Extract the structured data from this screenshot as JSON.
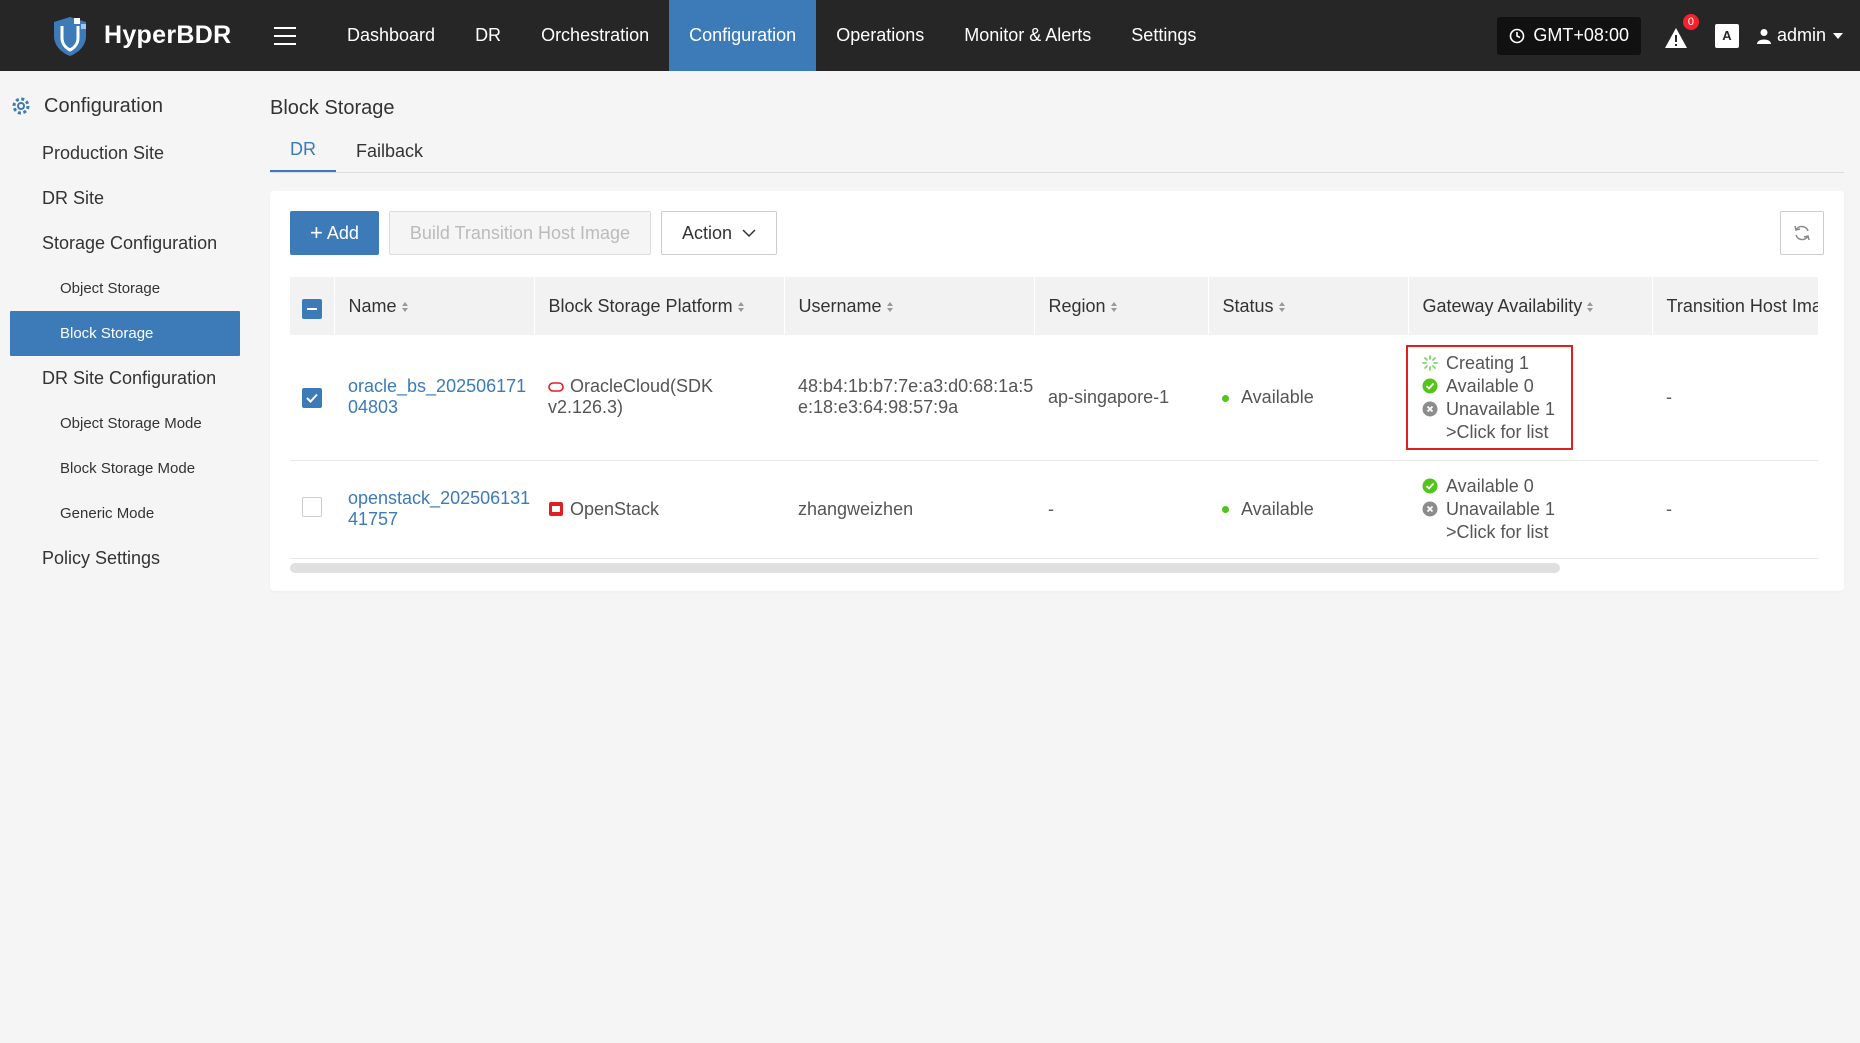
{
  "app": {
    "brand": "HyperBDR"
  },
  "nav": {
    "items": [
      {
        "label": "Dashboard",
        "active": false
      },
      {
        "label": "DR",
        "active": false
      },
      {
        "label": "Orchestration",
        "active": false
      },
      {
        "label": "Configuration",
        "active": true
      },
      {
        "label": "Operations",
        "active": false
      },
      {
        "label": "Monitor & Alerts",
        "active": false
      },
      {
        "label": "Settings",
        "active": false
      }
    ]
  },
  "header": {
    "timezone": "GMT+08:00",
    "alert_count": "0",
    "lang": "A",
    "user": "admin"
  },
  "sidebar": {
    "title": "Configuration",
    "items": [
      {
        "label": "Production Site",
        "level": 1
      },
      {
        "label": "DR Site",
        "level": 1
      },
      {
        "label": "Storage Configuration",
        "level": 1
      },
      {
        "label": "Object Storage",
        "level": 2
      },
      {
        "label": "Block Storage",
        "level": 2,
        "active": true
      },
      {
        "label": "DR Site Configuration",
        "level": 1
      },
      {
        "label": "Object Storage Mode",
        "level": 2
      },
      {
        "label": "Block Storage Mode",
        "level": 2
      },
      {
        "label": "Generic Mode",
        "level": 2
      },
      {
        "label": "Policy Settings",
        "level": 1
      }
    ]
  },
  "page": {
    "title": "Block Storage",
    "tabs": [
      {
        "label": "DR",
        "active": true
      },
      {
        "label": "Failback",
        "active": false
      }
    ]
  },
  "toolbar": {
    "add_label": "Add",
    "build_label": "Build Transition Host Image",
    "action_label": "Action"
  },
  "table": {
    "columns": [
      "Name",
      "Block Storage Platform",
      "Username",
      "Region",
      "Status",
      "Gateway Availability",
      "Transition Host Image"
    ],
    "rows": [
      {
        "name_line1": "oracle_bs_202506171",
        "name_line2": "04803",
        "platform_line1": "OracleCloud(SDK",
        "platform_line2": "v2.126.3)",
        "username_line1": "48:b4:1b:b7:7e:a3:d0:68:1a:5",
        "username_line2": "e:18:e3:64:98:57:9a",
        "region": "ap-singapore-1",
        "status": "Available",
        "gateway": {
          "creating": "Creating 1",
          "available": "Available 0",
          "unavailable": "Unavailable 1",
          "link": ">Click for list"
        },
        "image": "-",
        "checked": true
      },
      {
        "name_line1": "openstack_202506131",
        "name_line2": "41757",
        "platform_line1": "OpenStack",
        "username_line1": "zhangweizhen",
        "region": "-",
        "status": "Available",
        "gateway": {
          "available": "Available 0",
          "unavailable": "Unavailable 1",
          "link": ">Click for list"
        },
        "image": "-",
        "checked": false
      }
    ]
  },
  "colors": {
    "primary": "#3d7ab8",
    "topbar": "#262626",
    "success": "#52c41a",
    "highlight": "#e02020"
  }
}
